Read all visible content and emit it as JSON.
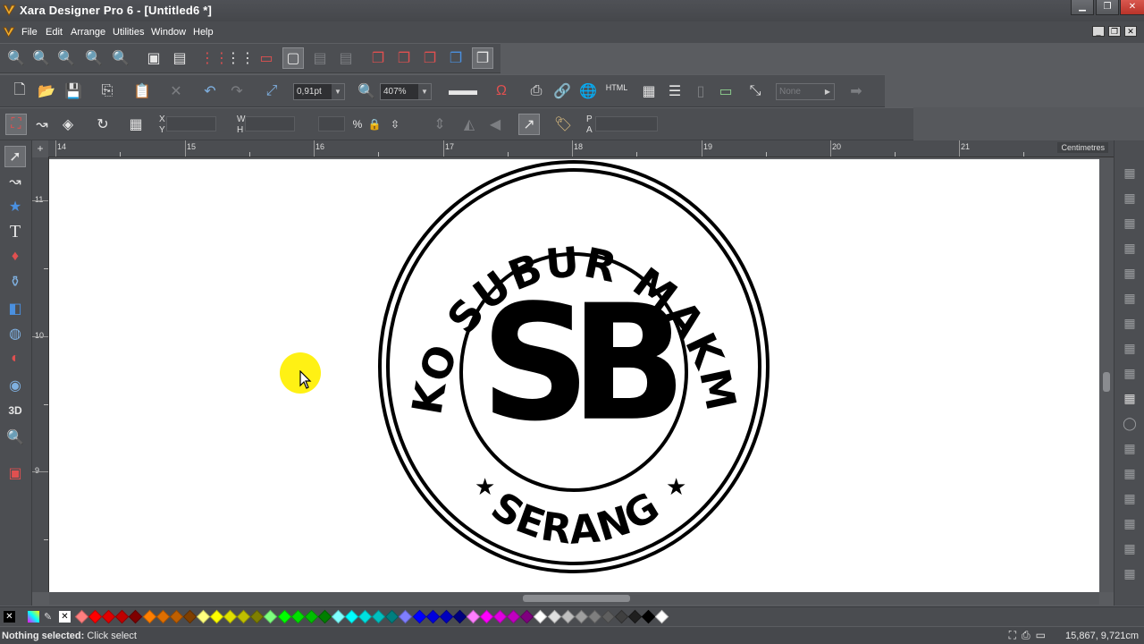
{
  "window": {
    "title": "Xara Designer Pro 6 - [Untitled6 *]"
  },
  "menu": {
    "items": [
      {
        "label": "File",
        "hot": "F"
      },
      {
        "label": "Edit",
        "hot": "E"
      },
      {
        "label": "Arrange",
        "hot": "A"
      },
      {
        "label": "Utilities",
        "hot": "U"
      },
      {
        "label": "Window",
        "hot": "W"
      },
      {
        "label": "Help",
        "hot": "H"
      }
    ]
  },
  "toolbar2": {
    "line_width": "0,91pt",
    "zoom": "407%",
    "html_label": "HTML",
    "none_label": "None"
  },
  "toolbar3": {
    "x_label": "X",
    "y_label": "Y",
    "w_label": "W",
    "h_label": "H",
    "p_label": "P",
    "a_label": "A"
  },
  "ruler": {
    "units": "Centimetres",
    "h_numbers": [
      "14",
      "15",
      "16",
      "17",
      "18",
      "19",
      "20",
      "21"
    ],
    "v_numbers": [
      "11",
      "10",
      "9"
    ]
  },
  "logo": {
    "top_text": "TOKO SUBUR MAKMUR",
    "bottom_text": "SERANG",
    "monogram": "SB",
    "star": "★"
  },
  "palette": {
    "colors": [
      "#ff7f7f",
      "#ff0000",
      "#df0000",
      "#bf0000",
      "#7f0000",
      "#ff7f00",
      "#df6f00",
      "#bf5f00",
      "#7f3f00",
      "#ffff7f",
      "#ffff00",
      "#dfdf00",
      "#bfbf00",
      "#7f7f00",
      "#7fff7f",
      "#00ff00",
      "#00df00",
      "#00bf00",
      "#007f00",
      "#7fffff",
      "#00ffff",
      "#00dfdf",
      "#00bfbf",
      "#007f7f",
      "#7f7fff",
      "#0000ff",
      "#0000df",
      "#0000bf",
      "#00007f",
      "#ff7fff",
      "#ff00ff",
      "#df00df",
      "#bf00bf",
      "#7f007f",
      "#ffffff",
      "#dfdfdf",
      "#bfbfbf",
      "#9f9f9f",
      "#7f7f7f",
      "#5f5f5f",
      "#3f3f3f",
      "#1f1f1f",
      "#000000",
      "#ffffff"
    ]
  },
  "status": {
    "message_bold": "Nothing selected:",
    "message": " Click select",
    "coords": "15,867, 9,721cm"
  }
}
